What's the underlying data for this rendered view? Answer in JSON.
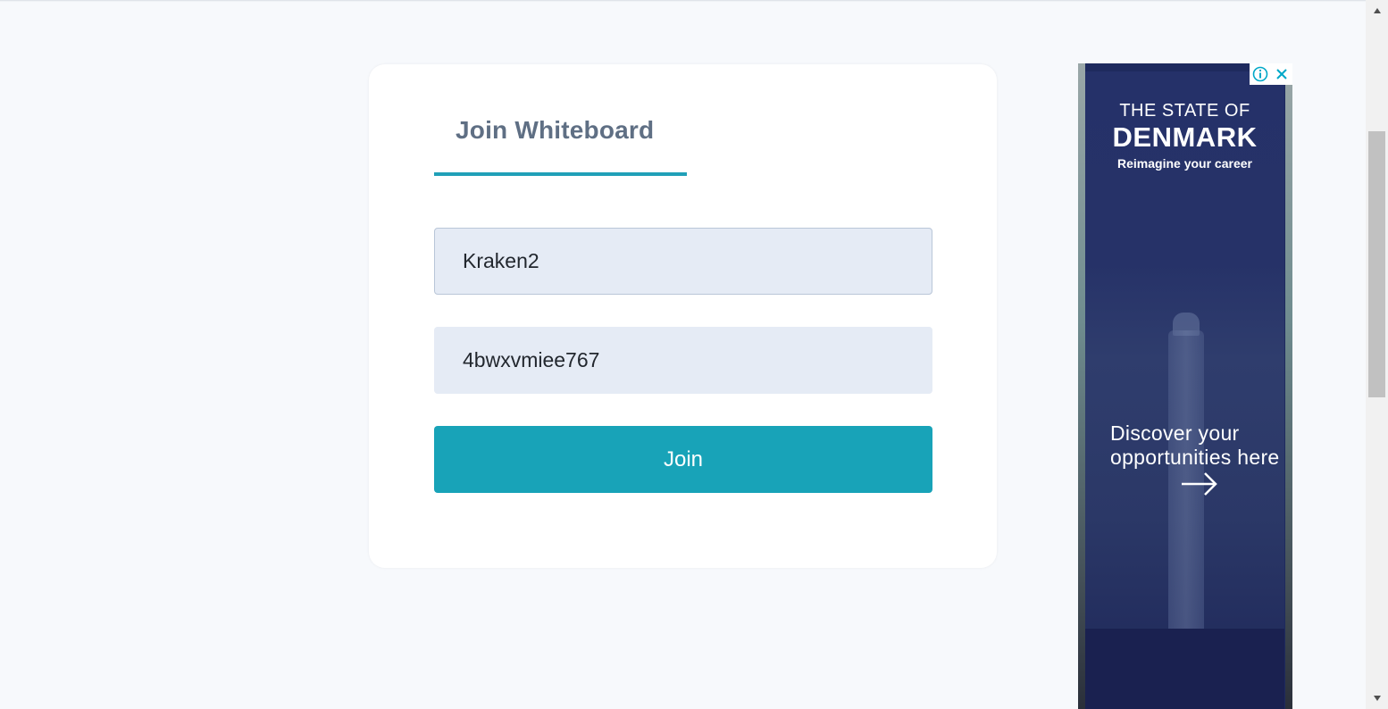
{
  "form": {
    "tab_label": "Join Whiteboard",
    "name_value": "Kraken2",
    "id_value": "4bwxvmiee767",
    "join_label": "Join"
  },
  "colors": {
    "accent": "#18a3b8",
    "field_bg": "#e5ebf5",
    "tab_text": "#5f6f84",
    "page_bg": "#f7f9fc"
  },
  "ad": {
    "line1": "THE STATE OF",
    "line2": "DENMARK",
    "line3": "Reimagine your career",
    "cta": "Discover your opportunities here",
    "info_icon": "info-icon",
    "close_icon": "close-icon",
    "arrow_icon": "arrow-right-icon"
  }
}
